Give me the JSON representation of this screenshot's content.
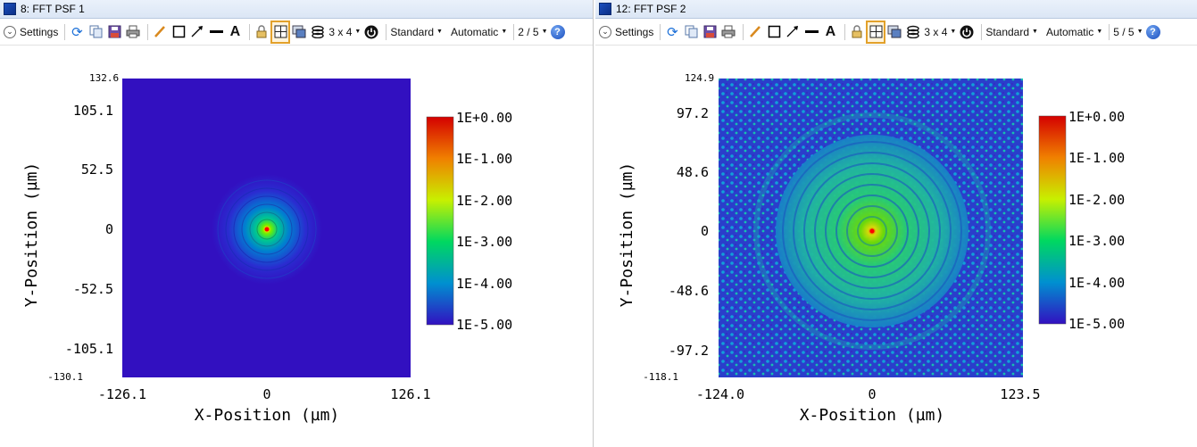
{
  "windows": [
    {
      "title": "8: FFT PSF 1",
      "toolbar": {
        "settings": "Settings",
        "layout": "3 x 4",
        "style": "Standard",
        "scale": "Automatic",
        "page": "2 / 5"
      },
      "plot": {
        "y_top_label": "132.6",
        "y_ticks": [
          "105.1",
          "52.5",
          "0",
          "-52.5",
          "-105.1"
        ],
        "y_bottom_label": "-130.1",
        "x_ticks": [
          "-126.1",
          "0",
          "126.1"
        ],
        "xlabel": "X-Position (µm)",
        "ylabel": "Y-Position (µm)",
        "colorbar": [
          "1E+0.00",
          "1E-1.00",
          "1E-2.00",
          "1E-3.00",
          "1E-4.00",
          "1E-5.00"
        ]
      }
    },
    {
      "title": "12: FFT PSF 2",
      "toolbar": {
        "settings": "Settings",
        "layout": "3 x 4",
        "style": "Standard",
        "scale": "Automatic",
        "page": "5 / 5"
      },
      "plot": {
        "y_top_label": "124.9",
        "y_ticks": [
          "97.2",
          "48.6",
          "0",
          "-48.6",
          "-97.2"
        ],
        "y_bottom_label": "-118.1",
        "x_ticks": [
          "-124.0",
          "0",
          "123.5"
        ],
        "xlabel": "X-Position (µm)",
        "ylabel": "Y-Position (µm)",
        "colorbar": [
          "1E+0.00",
          "1E-1.00",
          "1E-2.00",
          "1E-3.00",
          "1E-4.00",
          "1E-5.00"
        ]
      }
    }
  ],
  "colors": {
    "background_map": "#3210c0",
    "peak": "#d40000",
    "title_bar": "#dbe6f5"
  },
  "icons": [
    "settings-chevron-icon",
    "refresh-icon",
    "copy-icon",
    "save-icon",
    "print-icon",
    "pencil-icon",
    "rectangle-icon",
    "arrow-icon",
    "line-icon",
    "text-icon",
    "lock-icon",
    "grid-icon",
    "window-icon",
    "layers-icon",
    "power-icon",
    "help-icon"
  ]
}
